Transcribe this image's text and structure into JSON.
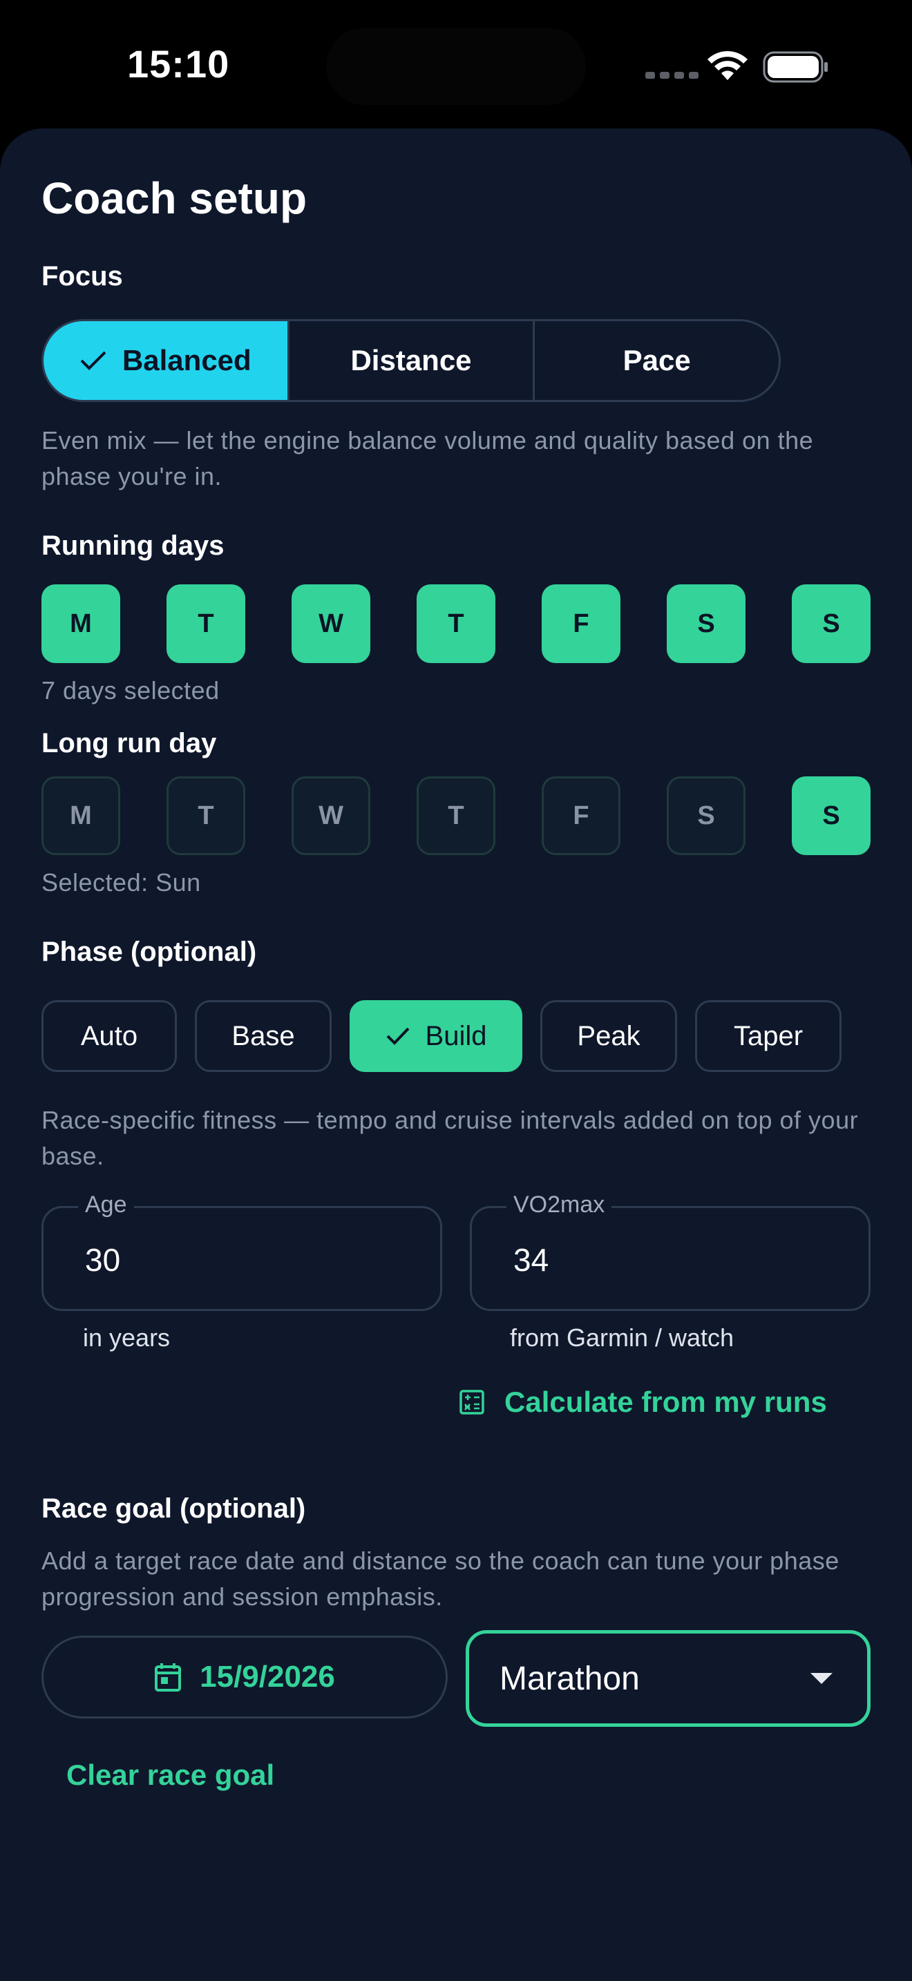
{
  "status_bar": {
    "time": "15:10"
  },
  "title": "Coach setup",
  "focus": {
    "label": "Focus",
    "options": [
      "Balanced",
      "Distance",
      "Pace"
    ],
    "selected": "Balanced",
    "description": "Even mix — let the engine balance volume and quality based on the phase you're in."
  },
  "running_days": {
    "label": "Running days",
    "days": [
      "M",
      "T",
      "W",
      "T",
      "F",
      "S",
      "S"
    ],
    "selected": [
      true,
      true,
      true,
      true,
      true,
      true,
      true
    ],
    "summary": "7 days selected"
  },
  "long_run_day": {
    "label": "Long run day",
    "days": [
      "M",
      "T",
      "W",
      "T",
      "F",
      "S",
      "S"
    ],
    "selected_index": 6,
    "summary": "Selected: Sun"
  },
  "phase": {
    "label": "Phase (optional)",
    "options": [
      "Auto",
      "Base",
      "Build",
      "Peak",
      "Taper"
    ],
    "selected": "Build",
    "description": "Race-specific fitness — tempo and cruise intervals added on top of your base."
  },
  "age": {
    "label": "Age",
    "value": "30",
    "helper": "in years"
  },
  "vo2max": {
    "label": "VO2max",
    "value": "34",
    "helper": "from Garmin / watch"
  },
  "calculate_link": "Calculate from my runs",
  "race_goal": {
    "label": "Race goal (optional)",
    "description": "Add a target race date and distance so the coach can tune your phase progression and session emphasis.",
    "date": "15/9/2026",
    "distance": "Marathon",
    "clear_label": "Clear race goal"
  },
  "colors": {
    "background": "#0f172b",
    "accent_cyan": "#22d3ee",
    "accent_green": "#34d399",
    "border": "#2d3b51"
  }
}
